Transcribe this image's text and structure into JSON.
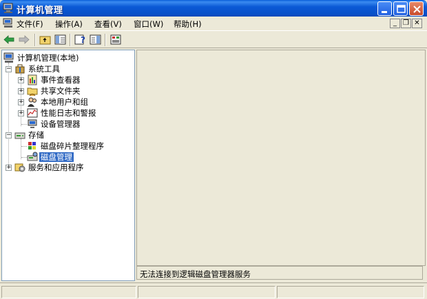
{
  "window": {
    "title": "计算机管理"
  },
  "menu": {
    "items": [
      "文件(F)",
      "操作(A)",
      "查看(V)",
      "窗口(W)",
      "帮助(H)"
    ]
  },
  "mdi_controls": {
    "minimize": "_",
    "restore": "❐",
    "close": "✕"
  },
  "toolbar": {
    "icons": [
      "back-arrow-icon",
      "forward-arrow-icon",
      "up-folder-icon",
      "show-hide-tree-icon",
      "help-icon",
      "properties-icon",
      "export-list-icon"
    ]
  },
  "tree": {
    "root": "计算机管理(本地)",
    "system_tools": "系统工具",
    "event_viewer": "事件查看器",
    "shared_folders": "共享文件夹",
    "local_users": "本地用户和组",
    "perf_logs": "性能日志和警报",
    "device_manager": "设备管理器",
    "storage": "存储",
    "defrag": "磁盘碎片整理程序",
    "disk_mgmt": "磁盘管理",
    "services_apps": "服务和应用程序"
  },
  "status": {
    "message": "无法连接到逻辑磁盘管理器服务"
  },
  "colors": {
    "titlebar": "#0b5ad6",
    "selection": "#316ac5",
    "chrome": "#ece9d8"
  }
}
